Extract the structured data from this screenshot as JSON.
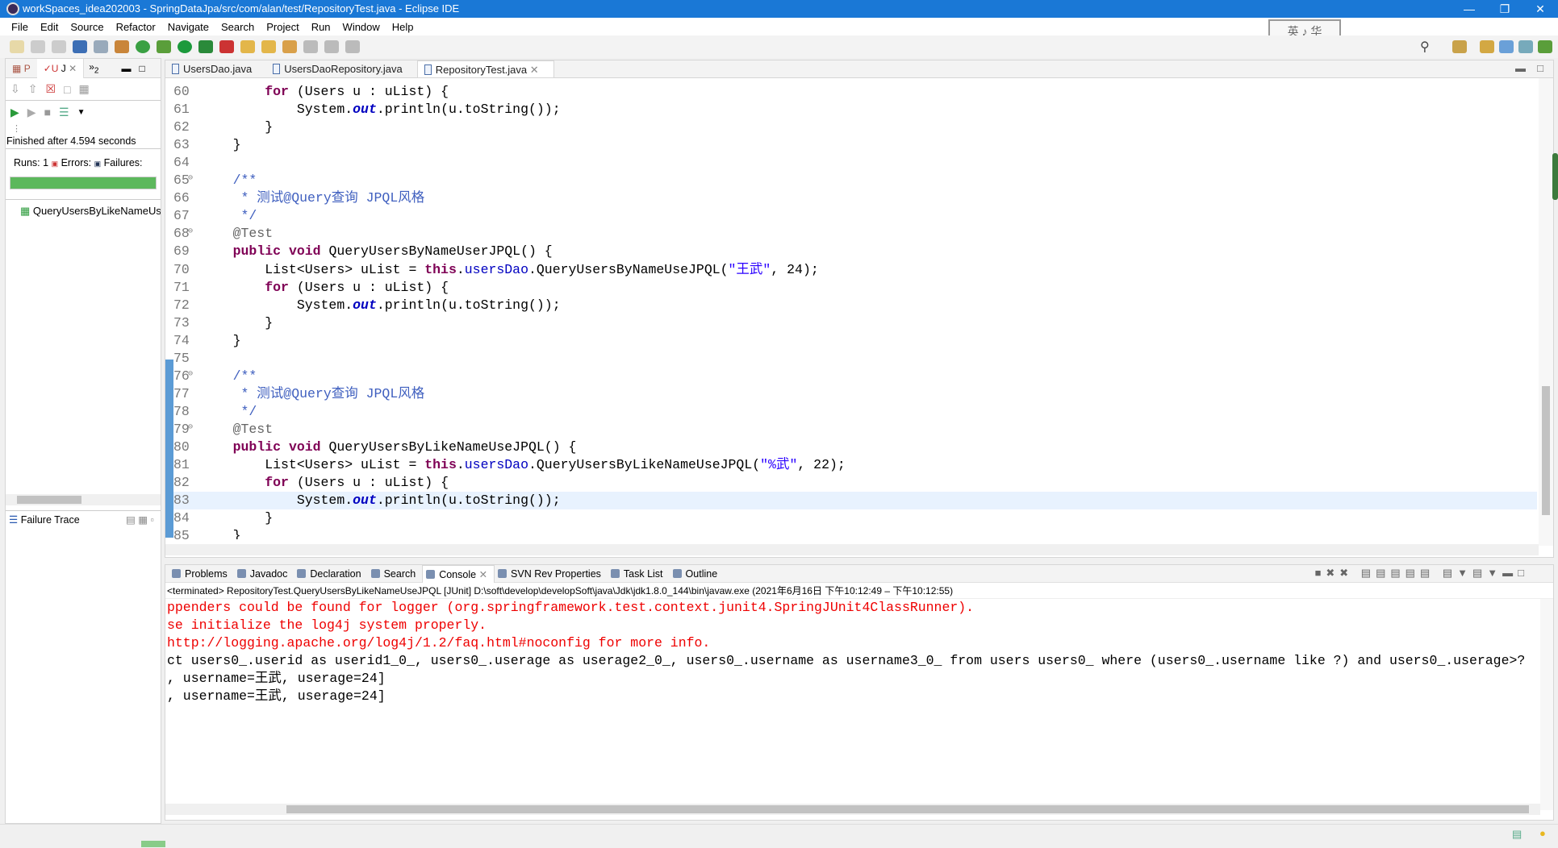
{
  "window": {
    "title": "workSpaces_idea202003 - SpringDataJpa/src/com/alan/test/RepositoryTest.java - Eclipse IDE"
  },
  "menu": [
    "File",
    "Edit",
    "Source",
    "Refactor",
    "Navigate",
    "Search",
    "Project",
    "Run",
    "Window",
    "Help"
  ],
  "ime_badge": "英 ♪ 华",
  "left": {
    "tabs": [
      "P",
      "J",
      "2"
    ],
    "finished": "Finished after 4.594 seconds",
    "runs_label": "Runs:",
    "runs": "1",
    "errors_label": "Errors:",
    "failures_label": "Failures:",
    "progress": 1.0,
    "progress_color": "#5cb85c",
    "tree_item": "QueryUsersByLikeNameUseJPQL",
    "failure_trace": "Failure Trace"
  },
  "editor": {
    "tabs": [
      {
        "label": "UsersDao.java"
      },
      {
        "label": "UsersDaoRepository.java"
      },
      {
        "label": "RepositoryTest.java",
        "active": true
      }
    ],
    "current_line": 83,
    "lines": [
      {
        "n": 60,
        "s": [
          [
            "",
            "        "
          ],
          [
            "kw",
            "for"
          ],
          [
            "",
            " (Users u : uList) {"
          ]
        ]
      },
      {
        "n": 61,
        "s": [
          [
            "",
            "            System."
          ],
          [
            "so",
            "out"
          ],
          [
            "",
            ".println(u.toString());"
          ]
        ]
      },
      {
        "n": 62,
        "s": [
          [
            "",
            "        }"
          ]
        ]
      },
      {
        "n": 63,
        "s": [
          [
            "",
            "    }"
          ]
        ]
      },
      {
        "n": 64,
        "s": []
      },
      {
        "n": 65,
        "fold": true,
        "s": [
          [
            "cm",
            "    /**"
          ]
        ]
      },
      {
        "n": 66,
        "s": [
          [
            "cm",
            "     * 测试@Query查询 JPQL风格"
          ]
        ]
      },
      {
        "n": 67,
        "s": [
          [
            "cm",
            "     */"
          ]
        ]
      },
      {
        "n": 68,
        "fold": true,
        "s": [
          [
            "an",
            "    @Test"
          ]
        ]
      },
      {
        "n": 69,
        "s": [
          [
            "",
            "    "
          ],
          [
            "kw",
            "public"
          ],
          [
            "",
            " "
          ],
          [
            "kw",
            "void"
          ],
          [
            "",
            " QueryUsersByNameUserJPQL() {"
          ]
        ]
      },
      {
        "n": 70,
        "s": [
          [
            "",
            "        List<Users> uList = "
          ],
          [
            "kw",
            "this"
          ],
          [
            "",
            "."
          ],
          [
            "fd",
            "usersDao"
          ],
          [
            "",
            ".QueryUsersByNameUseJPQL("
          ],
          [
            "st",
            "\"王武\""
          ],
          [
            "",
            ", 24);"
          ]
        ]
      },
      {
        "n": 71,
        "s": [
          [
            "",
            "        "
          ],
          [
            "kw",
            "for"
          ],
          [
            "",
            " (Users u : uList) {"
          ]
        ]
      },
      {
        "n": 72,
        "s": [
          [
            "",
            "            System."
          ],
          [
            "so",
            "out"
          ],
          [
            "",
            ".println(u.toString());"
          ]
        ]
      },
      {
        "n": 73,
        "s": [
          [
            "",
            "        }"
          ]
        ]
      },
      {
        "n": 74,
        "s": [
          [
            "",
            "    }"
          ]
        ]
      },
      {
        "n": 75,
        "s": []
      },
      {
        "n": 76,
        "fold": true,
        "s": [
          [
            "cm",
            "    /**"
          ]
        ]
      },
      {
        "n": 77,
        "s": [
          [
            "cm",
            "     * 测试@Query查询 JPQL风格"
          ]
        ]
      },
      {
        "n": 78,
        "s": [
          [
            "cm",
            "     */"
          ]
        ]
      },
      {
        "n": 79,
        "fold": true,
        "s": [
          [
            "an",
            "    @Test"
          ]
        ]
      },
      {
        "n": 80,
        "s": [
          [
            "",
            "    "
          ],
          [
            "kw",
            "public"
          ],
          [
            "",
            " "
          ],
          [
            "kw",
            "void"
          ],
          [
            "",
            " QueryUsersByLikeNameUseJPQL() {"
          ]
        ]
      },
      {
        "n": 81,
        "s": [
          [
            "",
            "        List<Users> uList = "
          ],
          [
            "kw",
            "this"
          ],
          [
            "",
            "."
          ],
          [
            "fd",
            "usersDao"
          ],
          [
            "",
            ".QueryUsersByLikeNameUseJPQL("
          ],
          [
            "st",
            "\"%武\""
          ],
          [
            "",
            ", 22);"
          ]
        ]
      },
      {
        "n": 82,
        "s": [
          [
            "",
            "        "
          ],
          [
            "kw",
            "for"
          ],
          [
            "",
            " (Users u : uList) {"
          ]
        ]
      },
      {
        "n": 83,
        "s": [
          [
            "",
            "            System."
          ],
          [
            "so",
            "out"
          ],
          [
            "",
            ".println(u.toString());"
          ]
        ]
      },
      {
        "n": 84,
        "s": [
          [
            "",
            "        }"
          ]
        ]
      },
      {
        "n": 85,
        "s": [
          [
            "",
            "    }"
          ]
        ]
      }
    ]
  },
  "bottom": {
    "tabs": [
      {
        "label": "Problems"
      },
      {
        "label": "Javadoc"
      },
      {
        "label": "Declaration"
      },
      {
        "label": "Search"
      },
      {
        "label": "Console",
        "active": true
      },
      {
        "label": "SVN Rev Properties"
      },
      {
        "label": "Task List"
      },
      {
        "label": "Outline"
      }
    ],
    "console_header": "<terminated> RepositoryTest.QueryUsersByLikeNameUseJPQL [JUnit] D:\\soft\\develop\\developSoft\\java\\Jdk\\jdk1.8.0_144\\bin\\javaw.exe  (2021年6月16日 下午10:12:49 – 下午10:12:55)",
    "console": [
      {
        "text": "ppenders could be found for logger (org.springframework.test.context.junit4.SpringJUnit4ClassRunner).",
        "err": true
      },
      {
        "text": "se initialize the log4j system properly.",
        "err": true
      },
      {
        "text": "http://logging.apache.org/log4j/1.2/faq.html#noconfig for more info.",
        "err": true
      },
      {
        "text": "ct users0_.userid as userid1_0_, users0_.userage as userage2_0_, users0_.username as username3_0_ from users users0_ where (users0_.username like ?) and users0_.userage>?",
        "err": false
      },
      {
        "text": ", username=王武, userage=24]",
        "err": false
      },
      {
        "text": ", username=王武, userage=24]",
        "err": false
      }
    ]
  }
}
